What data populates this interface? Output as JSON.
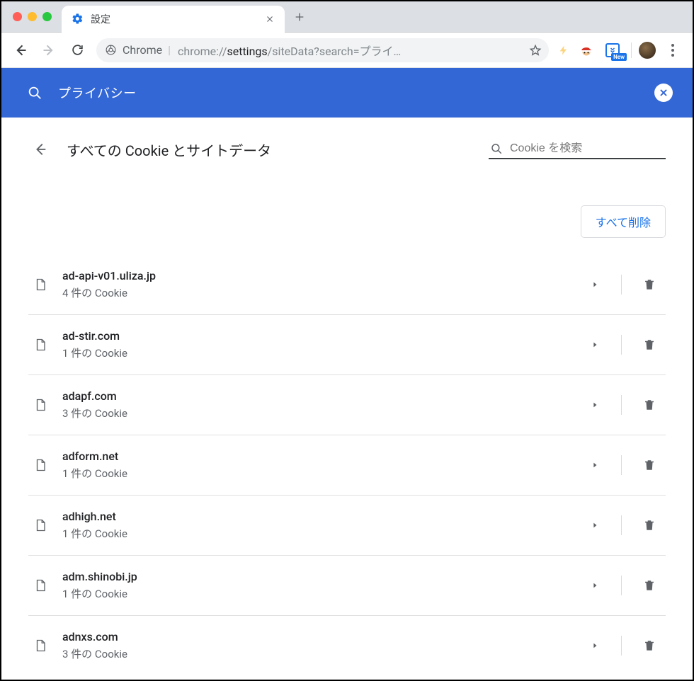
{
  "window": {
    "tab_title": "設定"
  },
  "omnibox": {
    "chip_label": "Chrome",
    "url_prefix": "chrome://",
    "url_bold": "settings",
    "url_rest": "/siteData?search=プライ…",
    "new_badge": "New"
  },
  "banner": {
    "query": "プライバシー"
  },
  "page": {
    "title": "すべての Cookie とサイトデータ",
    "cookie_search_placeholder": "Cookie を検索",
    "delete_all": "すべて削除"
  },
  "sites": [
    {
      "domain": "ad-api-v01.uliza.jp",
      "count": "4 件の Cookie"
    },
    {
      "domain": "ad-stir.com",
      "count": "1 件の Cookie"
    },
    {
      "domain": "adapf.com",
      "count": "3 件の Cookie"
    },
    {
      "domain": "adform.net",
      "count": "1 件の Cookie"
    },
    {
      "domain": "adhigh.net",
      "count": "1 件の Cookie"
    },
    {
      "domain": "adm.shinobi.jp",
      "count": "1 件の Cookie"
    },
    {
      "domain": "adnxs.com",
      "count": "3 件の Cookie"
    }
  ]
}
